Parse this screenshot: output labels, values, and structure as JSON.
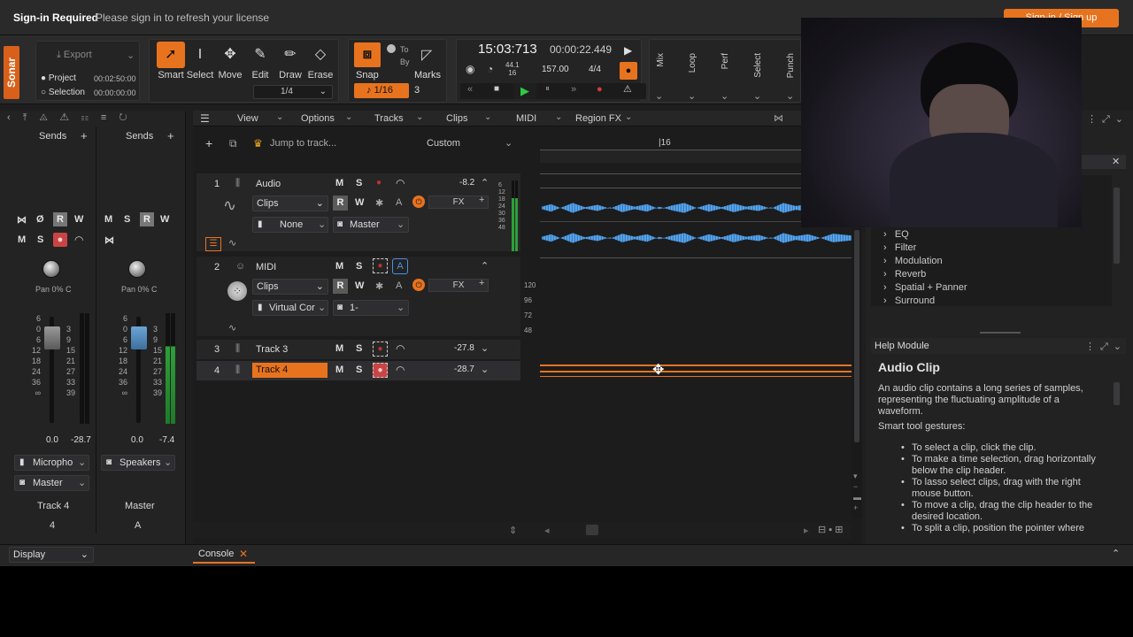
{
  "signin": {
    "title": "Sign-in Required",
    "message": "Please sign in to refresh your license",
    "button": "Sign-in / Sign up"
  },
  "app": {
    "logo": "Sonar",
    "accent": "#e8731e"
  },
  "export": {
    "label": "Export",
    "project_label": "Project",
    "project_time": "00:02:50:00",
    "selection_label": "Selection",
    "selection_time": "00:00:00:00"
  },
  "tools": [
    {
      "label": "Smart",
      "icon": "smart-arrow-icon"
    },
    {
      "label": "Select",
      "icon": "select-cursor-icon"
    },
    {
      "label": "Move",
      "icon": "move-icon"
    },
    {
      "label": "Edit",
      "icon": "edit-icon"
    },
    {
      "label": "Draw",
      "icon": "pencil-icon"
    },
    {
      "label": "Erase",
      "icon": "eraser-icon"
    }
  ],
  "tool_quantize": "1/4",
  "snap": {
    "label": "Snap",
    "to": "To",
    "by": "By",
    "value": "1/16",
    "count": "3",
    "marks": "Marks"
  },
  "transport": {
    "time": "15:03:713",
    "clock": "00:00:22.449",
    "sample_rate_top": "44.1",
    "sample_rate_bottom": "16",
    "tempo": "157.00",
    "meter": "4/4"
  },
  "modules": [
    "Mix",
    "Loop",
    "Perf",
    "Select",
    "Punch"
  ],
  "mixer": {
    "sends_label": "Sends",
    "strips": [
      {
        "name": "Track 4",
        "number": "4",
        "pan": "Pan 0% C",
        "vol": "0.0",
        "peak": "-28.7",
        "input": "Micropho",
        "output": "Master"
      },
      {
        "name": "Master",
        "number": "A",
        "pan": "Pan 0% C",
        "vol": "0.0",
        "peak": "-7.4",
        "input": "Speakers",
        "output": ""
      }
    ],
    "scale": [
      "6",
      "0",
      "6",
      "12",
      "18",
      "24",
      "36",
      "∞"
    ],
    "meter_scale": [
      "3",
      "9",
      "15",
      "21",
      "27",
      "33",
      "39"
    ]
  },
  "display_dropdown": "Display",
  "trackmenu": [
    "View",
    "Options",
    "Tracks",
    "Clips",
    "MIDI",
    "Region FX"
  ],
  "jump": {
    "placeholder": "Jump to track...",
    "preset": "Custom"
  },
  "ruler": {
    "mark": "16"
  },
  "tracks": [
    {
      "num": "1",
      "name": "Audio",
      "level": "-8.2",
      "clips": "Clips",
      "input": "None",
      "output": "Master",
      "fx": "FX"
    },
    {
      "num": "2",
      "name": "MIDI",
      "level": "",
      "clips": "Clips",
      "input": "Virtual Cor",
      "output": "1-",
      "fx": "FX"
    },
    {
      "num": "3",
      "name": "Track 3",
      "level": "-27.8"
    },
    {
      "num": "4",
      "name": "Track 4",
      "level": "-28.7"
    }
  ],
  "meter_labels": [
    "6",
    "12",
    "18",
    "24",
    "30",
    "36",
    "48"
  ],
  "midi_scale": [
    "120",
    "96",
    "72",
    "48"
  ],
  "browser": {
    "items": [
      "EQ",
      "Filter",
      "Modulation",
      "Reverb",
      "Spatial + Panner",
      "Surround"
    ]
  },
  "help": {
    "header": "Help Module",
    "title": "Audio Clip",
    "intro": "An audio clip contains a long series of samples, representing the fluctuating amplitude of a waveform.",
    "gestures_label": "Smart tool gestures:",
    "bullets": [
      "To select a clip, click the clip.",
      "To make a time selection, drag horizontally below the clip header.",
      "To lasso select clips, drag with the right mouse button.",
      "To move a clip, drag the clip header to the desired location.",
      "To split a clip, position the pointer where"
    ]
  },
  "console": {
    "tab": "Console"
  }
}
